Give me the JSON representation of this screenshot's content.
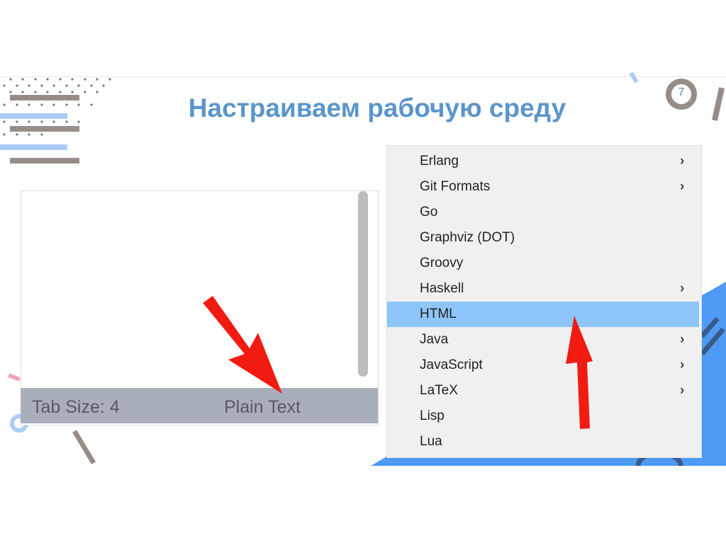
{
  "slide": {
    "title": "Настраиваем рабочую среду",
    "page_number": "7"
  },
  "editor": {
    "tab_size": "Tab Size: 4",
    "syntax": "Plain Text"
  },
  "menu": {
    "items": [
      {
        "label": "Erlang",
        "submenu": true
      },
      {
        "label": "Git Formats",
        "submenu": true
      },
      {
        "label": "Go",
        "submenu": false
      },
      {
        "label": "Graphviz (DOT)",
        "submenu": false
      },
      {
        "label": "Groovy",
        "submenu": false
      },
      {
        "label": "Haskell",
        "submenu": true
      },
      {
        "label": "HTML",
        "submenu": false,
        "selected": true
      },
      {
        "label": "Java",
        "submenu": true
      },
      {
        "label": "JavaScript",
        "submenu": true
      },
      {
        "label": "LaTeX",
        "submenu": true
      },
      {
        "label": "Lisp",
        "submenu": false
      },
      {
        "label": "Lua",
        "submenu": false
      }
    ]
  },
  "colors": {
    "accent": "#5b95cb",
    "highlight": "#8ec5fa",
    "arrow": "#f21b12",
    "deco_blue": "#4e9af5"
  }
}
